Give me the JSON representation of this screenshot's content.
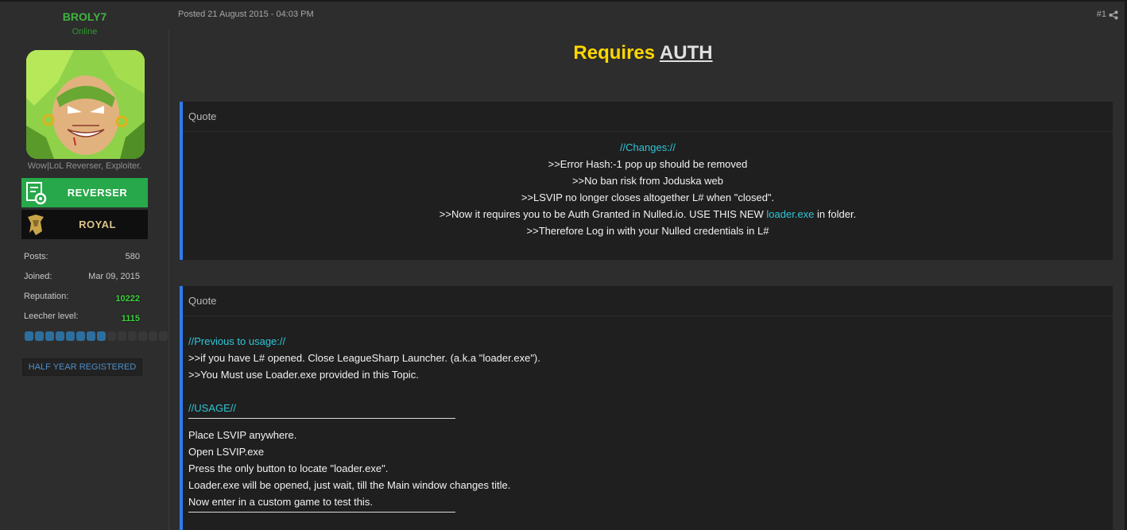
{
  "user": {
    "username": "BROLY7",
    "status": "Online",
    "title": "Wow|LoL Reverser, Exploiter.",
    "badges": [
      "REVERSER",
      "ROYAL"
    ],
    "stats": {
      "posts_label": "Posts:",
      "posts_value": "580",
      "joined_label": "Joined:",
      "joined_value": "Mar 09, 2015",
      "reputation_label": "Reputation:",
      "reputation_value": "10222",
      "leecher_label": "Leecher level:",
      "leecher_value": "1115",
      "leecher_segments_total": 14,
      "leecher_segments_filled": 8
    },
    "registered_badge": "HALF YEAR REGISTERED"
  },
  "post": {
    "posted": "Posted 21 August 2015 - 04:03 PM",
    "number": "#1",
    "title_part1": "Requires",
    "title_part2": "AUTH"
  },
  "quote1": {
    "label": "Quote",
    "heading": "//Changes://",
    "lines": [
      ">>Error Hash:-1 pop up should be removed",
      ">>No ban risk from Joduska web",
      ">>LSVIP no longer closes altogether L# when \"closed\"."
    ],
    "line4_before": ">>Now it requires you to be Auth Granted in Nulled.io. USE THIS NEW",
    "line4_link": "loader.exe",
    "line4_after": "in folder.",
    "line5": ">>Therefore Log in with your Nulled credentials in L#"
  },
  "quote2": {
    "label": "Quote",
    "heading1": "//Previous to usage://",
    "pre_lines": [
      ">>if you have L# opened. Close LeagueSharp Launcher. (a.k.a \"loader.exe\").",
      ">>You Must use Loader.exe provided in this Topic."
    ],
    "heading2": "//USAGE//",
    "usage_lines": [
      "Place LSVIP anywhere.",
      "Open LSVIP.exe",
      "Press the only button to locate \"loader.exe\".",
      "Loader.exe will be opened, just wait, till the Main window changes title.",
      "Now enter in a custom game to test this."
    ]
  },
  "colors": {
    "accent_blue": "#2f7cf0",
    "username_green": "#3fb33f",
    "title_yellow": "#ffd700",
    "cyan_text": "#2fc6d6",
    "reverser_green": "#27a84a"
  }
}
